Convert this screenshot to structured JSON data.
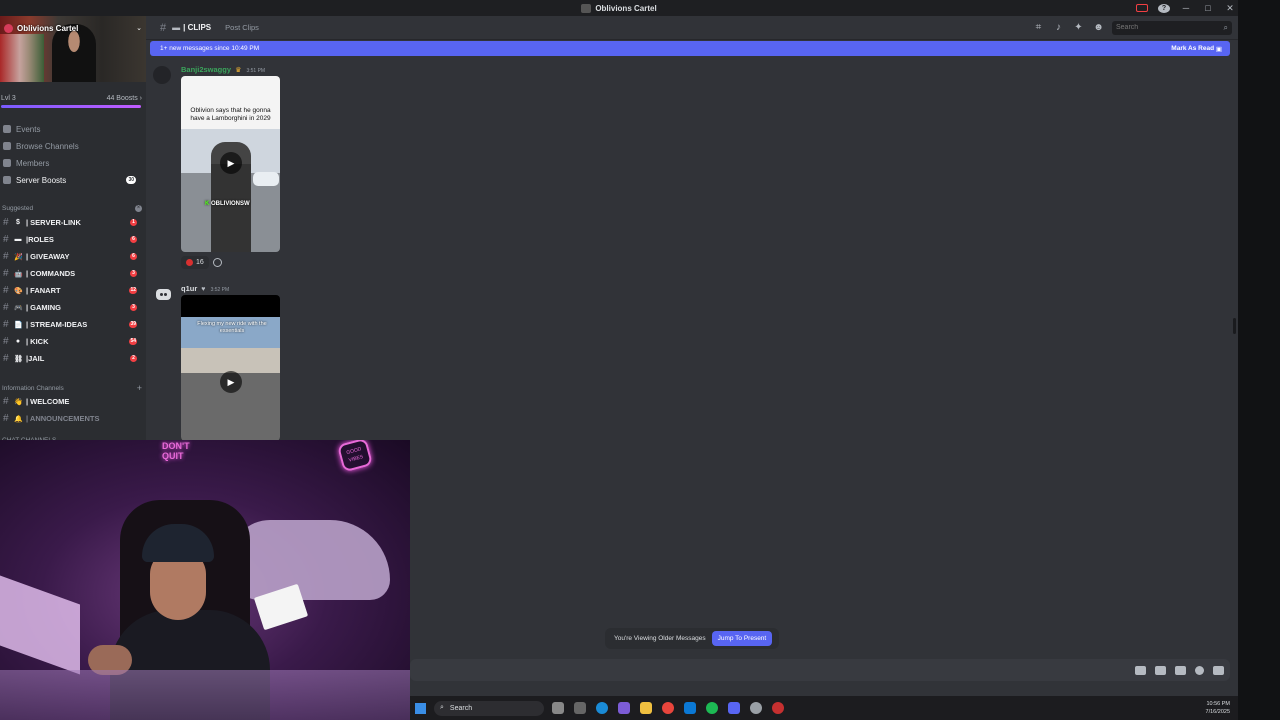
{
  "window": {
    "title": "Oblivions Cartel"
  },
  "server": {
    "name": "Oblivions Cartel",
    "level": "Lvl 3",
    "boosts": "44 Boosts"
  },
  "nav": [
    {
      "label": "Events",
      "icon": "calendar-icon"
    },
    {
      "label": "Browse Channels",
      "icon": "browse-icon"
    },
    {
      "label": "Members",
      "icon": "members-icon"
    },
    {
      "label": "Server Boosts",
      "icon": "boost-icon",
      "badge": "30"
    }
  ],
  "sections": {
    "suggested": "Suggested",
    "information": "Information Channels",
    "chat": "CHAT CHANNELS"
  },
  "suggested_channels": [
    {
      "emoji": "$",
      "name": "| SERVER-LINK",
      "mentions": "1"
    },
    {
      "emoji": "▬",
      "name": "|ROLES",
      "mentions": "6"
    },
    {
      "emoji": "🎉",
      "name": "| GIVEAWAY",
      "mentions": "6"
    },
    {
      "emoji": "🤖",
      "name": "| COMMANDS",
      "mentions": "3"
    },
    {
      "emoji": "🎨",
      "name": "| FANART",
      "mentions": "12"
    },
    {
      "emoji": "🎮",
      "name": "| GAMING",
      "mentions": "3"
    },
    {
      "emoji": "📄",
      "name": "| STREAM-IDEAS",
      "mentions": "39"
    },
    {
      "emoji": "●",
      "name": "| KICK",
      "mentions": "54"
    },
    {
      "emoji": "⛓",
      "name": "|JAIL",
      "mentions": "2"
    }
  ],
  "info_channels": [
    {
      "emoji": "👋",
      "name": "| WELCOME"
    },
    {
      "emoji": "🔔",
      "name": "| ANNOUNCEMENTS"
    }
  ],
  "header": {
    "channel": "| CLIPS",
    "post_tab": "Post Clips",
    "search_placeholder": "Search"
  },
  "new_messages": {
    "text": "1+ new messages since 10:49 PM",
    "mark_read": "Mark As Read"
  },
  "messages": [
    {
      "author": "Banji2swaggy",
      "author_color": "#3ba55c",
      "time": "3:51 PM",
      "video_caption": "Oblivion says that he gonna have a Lamborghini in 2029",
      "watermark": "OBLIVIONSW",
      "reaction_count": "16"
    },
    {
      "author": "q1ur",
      "author_color": "#f2f3f5",
      "time": "3:52 PM",
      "video_caption": "Flexing my new ride with the essentials"
    }
  ],
  "jump": {
    "notice": "You're Viewing Older Messages",
    "button": "Jump To Present"
  },
  "webcam": {
    "neon_left": "DON'T QUIT",
    "neon_right": "GOOD VIBES"
  },
  "taskbar": {
    "search": "Search",
    "time": "10:56 PM",
    "date": "7/16/2025"
  },
  "colors": {
    "accent": "#5865f2",
    "background": "#313338",
    "sidebar": "#2b2d31",
    "mention": "#f23f43"
  }
}
